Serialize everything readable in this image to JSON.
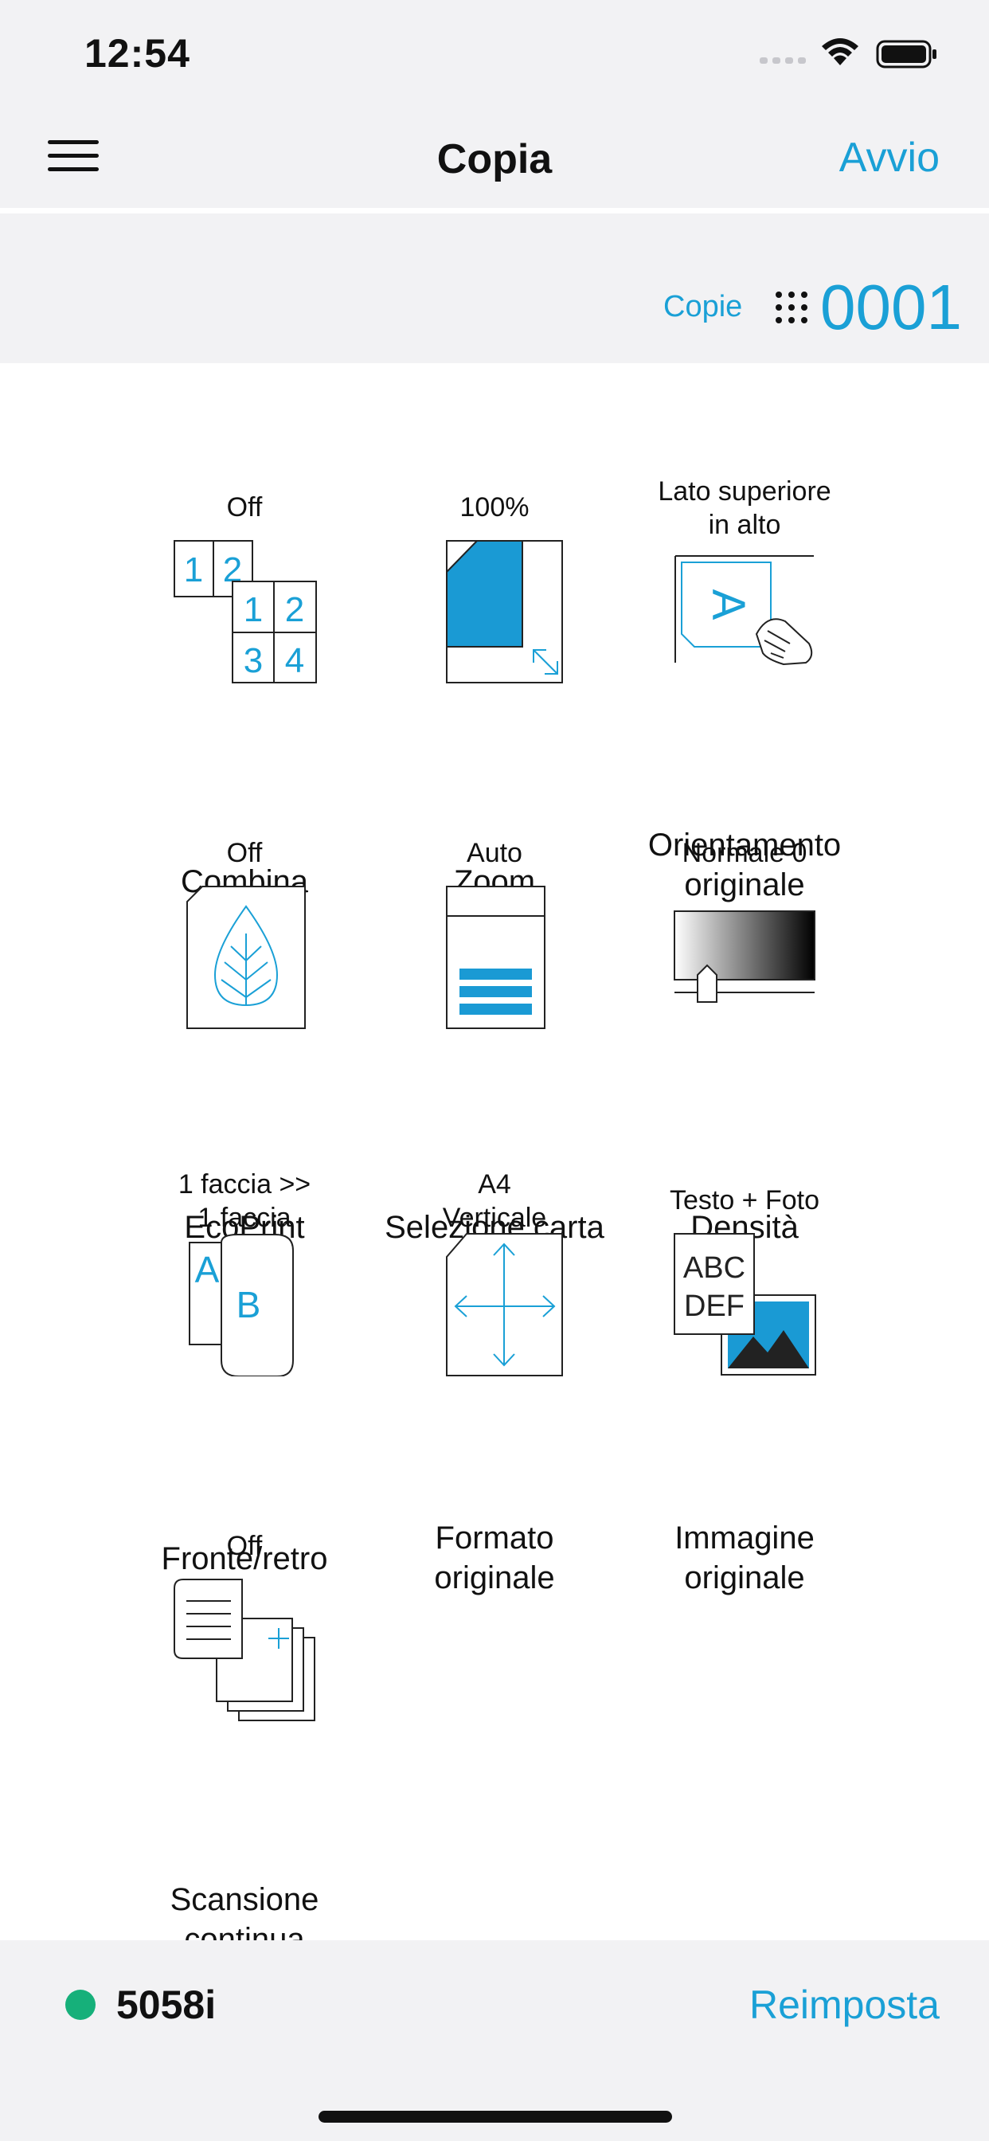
{
  "status_bar": {
    "time": "12:54"
  },
  "nav": {
    "title": "Copia",
    "action": "Avvio"
  },
  "copies": {
    "label": "Copie",
    "value": "0001"
  },
  "tiles": [
    {
      "status": "Off",
      "label": "Combina",
      "icon": "combine-icon"
    },
    {
      "status": "100%",
      "label": "Zoom",
      "icon": "zoom-icon"
    },
    {
      "status": "Lato superiore\nin alto",
      "label": "Orientamento\noriginale",
      "icon": "orientation-icon"
    },
    {
      "status": "Off",
      "label": "EcoPrint",
      "icon": "ecoprint-icon"
    },
    {
      "status": "Auto",
      "label": "Selezione carta",
      "icon": "paper-select-icon"
    },
    {
      "status": "Normale 0",
      "label": "Densità",
      "icon": "density-icon"
    },
    {
      "status": "1 faccia >>\n1 faccia",
      "label": "Fronte/retro",
      "icon": "duplex-icon"
    },
    {
      "status": "A4\nVerticale",
      "label": "Formato\noriginale",
      "icon": "original-size-icon"
    },
    {
      "status": "Testo + Foto",
      "label": "Immagine\noriginale",
      "icon": "original-image-icon"
    },
    {
      "status": "Off",
      "label": "Scansione\ncontinua",
      "icon": "continuous-scan-icon"
    }
  ],
  "footer": {
    "device": "5058i",
    "reset": "Reimposta",
    "device_status_color": "#16b07a"
  },
  "colors": {
    "accent": "#1aa0d6"
  }
}
